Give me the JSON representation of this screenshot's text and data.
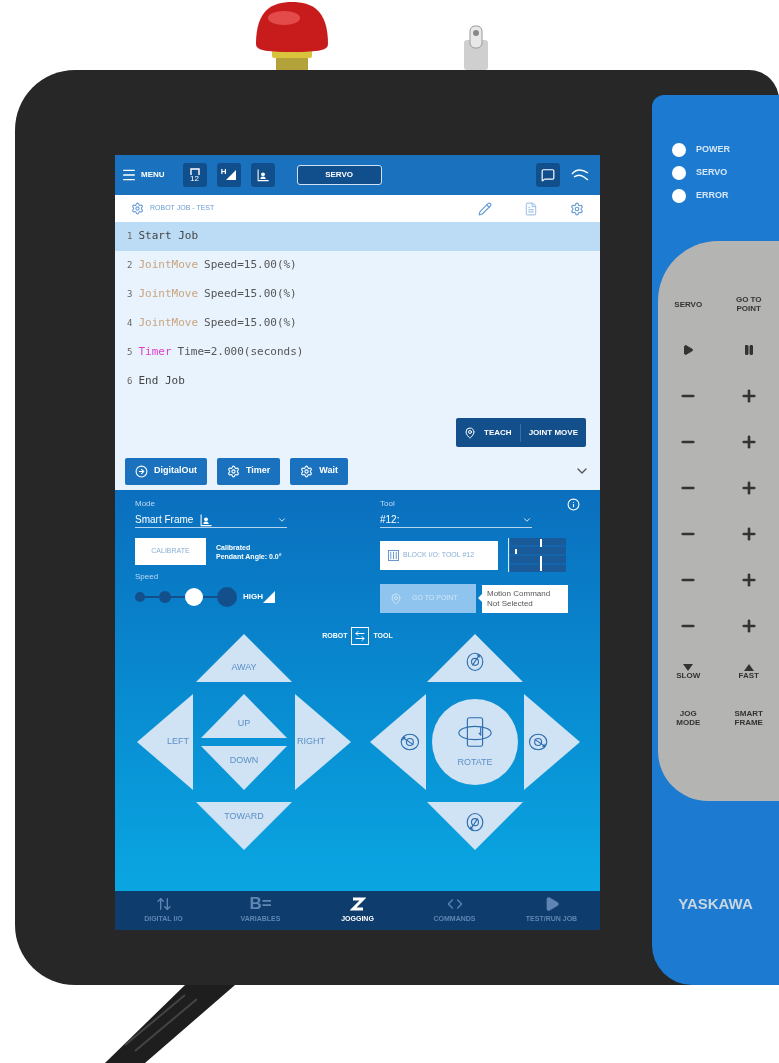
{
  "top_bar": {
    "menu_label": "MENU",
    "tool_number": "12",
    "speed_letter": "H",
    "servo_button": "SERVO"
  },
  "job": {
    "title": "ROBOT JOB - TEST",
    "lines": [
      {
        "number": "1",
        "kind": "plain",
        "text": "Start Job",
        "selected": true
      },
      {
        "number": "2",
        "kind": "move",
        "keyword": "JointMove",
        "text": "Speed=15.00(%)",
        "selected": false
      },
      {
        "number": "3",
        "kind": "move",
        "keyword": "JointMove",
        "text": "Speed=15.00(%)",
        "selected": false
      },
      {
        "number": "4",
        "kind": "move",
        "keyword": "JointMove",
        "text": "Speed=15.00(%)",
        "selected": false
      },
      {
        "number": "5",
        "kind": "timer",
        "keyword": "Timer",
        "text": "Time=2.000(seconds)",
        "selected": false
      },
      {
        "number": "6",
        "kind": "plain",
        "text": "End Job",
        "selected": false
      }
    ]
  },
  "teach_button": {
    "teach": "TEACH",
    "mode": "JOINT MOVE"
  },
  "command_buttons": [
    {
      "label": "DigitalOut",
      "kind": "io"
    },
    {
      "label": "Timer",
      "kind": "settings"
    },
    {
      "label": "Wait",
      "kind": "settings"
    }
  ],
  "jog": {
    "mode_label": "Mode",
    "mode_value": "Smart Frame",
    "tool_label": "Tool",
    "tool_value": "#12:",
    "calibrate": "CALIBRATE",
    "calibration_status": "Calibrated",
    "pendant_angle": "Pendant Angle: 0.0°",
    "speed_label": "Speed",
    "speed_steps": [
      {
        "selected": false
      },
      {
        "selected": false
      },
      {
        "selected": true
      },
      {
        "selected": false
      }
    ],
    "speed_value": "HIGH",
    "block_io": "BLOCK I/O: TOOL #12",
    "go_to_point": {
      "label": "GO TO POINT",
      "disabled": true
    },
    "tooltip": "Motion Command Not Selected",
    "frame_toggle": {
      "left": "ROBOT",
      "right": "TOOL"
    },
    "translate_pad": {
      "away": "AWAY",
      "left": "LEFT",
      "up": "UP",
      "down": "DOWN",
      "right": "RIGHT",
      "toward": "TOWARD"
    },
    "rotate_pad": {
      "center": "ROTATE"
    }
  },
  "bottom_nav": [
    {
      "label": "DIGITAL I/O",
      "kind": "io",
      "selected": false
    },
    {
      "label": "VARIABLES",
      "kind": "variables",
      "glyph": "B=",
      "selected": false
    },
    {
      "label": "JOGGING",
      "kind": "jog",
      "selected": true
    },
    {
      "label": "COMMANDS",
      "kind": "code",
      "selected": false
    },
    {
      "label": "TEST/RUN JOB",
      "kind": "play",
      "selected": false
    }
  ],
  "side_panel": {
    "leds": [
      "POWER",
      "SERVO",
      "ERROR"
    ],
    "servo": "SERVO",
    "go_to_point": "GO TO POINT",
    "slow": "SLOW",
    "fast": "FAST",
    "jog_mode": "JOG MODE",
    "smart_frame": "SMART FRAME",
    "brand": "YASKAWA"
  }
}
